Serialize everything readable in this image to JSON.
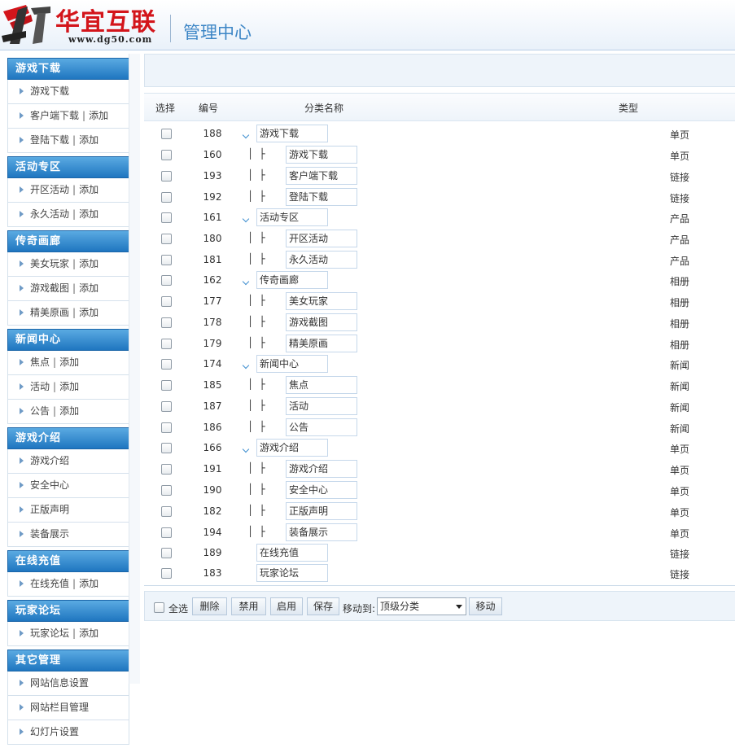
{
  "header": {
    "logo_text": "华宜互联",
    "logo_url": "www.dg50.com",
    "title": "管理中心"
  },
  "sidebar": {
    "add_label": "添加",
    "separator": "|",
    "groups": [
      {
        "title": "游戏下载",
        "items": [
          {
            "label": "游戏下载",
            "has_add": false
          },
          {
            "label": "客户端下载",
            "has_add": true
          },
          {
            "label": "登陆下载",
            "has_add": true
          }
        ]
      },
      {
        "title": "活动专区",
        "items": [
          {
            "label": "开区活动",
            "has_add": true
          },
          {
            "label": "永久活动",
            "has_add": true
          }
        ]
      },
      {
        "title": "传奇画廊",
        "items": [
          {
            "label": "美女玩家",
            "has_add": true
          },
          {
            "label": "游戏截图",
            "has_add": true
          },
          {
            "label": "精美原画",
            "has_add": true
          }
        ]
      },
      {
        "title": "新闻中心",
        "items": [
          {
            "label": "焦点",
            "has_add": true
          },
          {
            "label": "活动",
            "has_add": true
          },
          {
            "label": "公告",
            "has_add": true
          }
        ]
      },
      {
        "title": "游戏介绍",
        "items": [
          {
            "label": "游戏介绍",
            "has_add": false
          },
          {
            "label": "安全中心",
            "has_add": false
          },
          {
            "label": "正版声明",
            "has_add": false
          },
          {
            "label": "装备展示",
            "has_add": false
          }
        ]
      },
      {
        "title": "在线充值",
        "items": [
          {
            "label": "在线充值",
            "has_add": true
          }
        ]
      },
      {
        "title": "玩家论坛",
        "items": [
          {
            "label": "玩家论坛",
            "has_add": true
          }
        ]
      },
      {
        "title": "其它管理",
        "items": [
          {
            "label": "网站信息设置",
            "has_add": false
          },
          {
            "label": "网站栏目管理",
            "has_add": false
          },
          {
            "label": "幻灯片设置",
            "has_add": false
          }
        ]
      }
    ]
  },
  "table": {
    "headers": {
      "select": "选择",
      "id": "编号",
      "name": "分类名称",
      "type": "类型"
    },
    "tree_branch": "│ ├",
    "rows": [
      {
        "id": "188",
        "name": "游戏下载",
        "type": "单页",
        "level": 0,
        "arrow": true
      },
      {
        "id": "160",
        "name": "游戏下载",
        "type": "单页",
        "level": 1,
        "arrow": false
      },
      {
        "id": "193",
        "name": "客户端下载",
        "type": "链接",
        "level": 1,
        "arrow": false
      },
      {
        "id": "192",
        "name": "登陆下载",
        "type": "链接",
        "level": 1,
        "arrow": false
      },
      {
        "id": "161",
        "name": "活动专区",
        "type": "产品",
        "level": 0,
        "arrow": true
      },
      {
        "id": "180",
        "name": "开区活动",
        "type": "产品",
        "level": 1,
        "arrow": false
      },
      {
        "id": "181",
        "name": "永久活动",
        "type": "产品",
        "level": 1,
        "arrow": false
      },
      {
        "id": "162",
        "name": "传奇画廊",
        "type": "相册",
        "level": 0,
        "arrow": true
      },
      {
        "id": "177",
        "name": "美女玩家",
        "type": "相册",
        "level": 1,
        "arrow": false
      },
      {
        "id": "178",
        "name": "游戏截图",
        "type": "相册",
        "level": 1,
        "arrow": false
      },
      {
        "id": "179",
        "name": "精美原画",
        "type": "相册",
        "level": 1,
        "arrow": false
      },
      {
        "id": "174",
        "name": "新闻中心",
        "type": "新闻",
        "level": 0,
        "arrow": true
      },
      {
        "id": "185",
        "name": "焦点",
        "type": "新闻",
        "level": 1,
        "arrow": false
      },
      {
        "id": "187",
        "name": "活动",
        "type": "新闻",
        "level": 1,
        "arrow": false
      },
      {
        "id": "186",
        "name": "公告",
        "type": "新闻",
        "level": 1,
        "arrow": false
      },
      {
        "id": "166",
        "name": "游戏介绍",
        "type": "单页",
        "level": 0,
        "arrow": true
      },
      {
        "id": "191",
        "name": "游戏介绍",
        "type": "单页",
        "level": 1,
        "arrow": false
      },
      {
        "id": "190",
        "name": "安全中心",
        "type": "单页",
        "level": 1,
        "arrow": false
      },
      {
        "id": "182",
        "name": "正版声明",
        "type": "单页",
        "level": 1,
        "arrow": false
      },
      {
        "id": "194",
        "name": "装备展示",
        "type": "单页",
        "level": 1,
        "arrow": false
      },
      {
        "id": "189",
        "name": "在线充值",
        "type": "链接",
        "level": 0,
        "arrow": false
      },
      {
        "id": "183",
        "name": "玩家论坛",
        "type": "链接",
        "level": 0,
        "arrow": false
      }
    ]
  },
  "bottombar": {
    "select_all": "全选",
    "buttons": {
      "delete": "删除",
      "disable": "禁用",
      "enable": "启用",
      "save": "保存",
      "move": "移动"
    },
    "move_to_label": "移动到:",
    "move_target": "顶级分类"
  },
  "colors": {
    "brand_red": "#d3151b",
    "accent_blue": "#3d86c6",
    "sidebar_header": "#1f76c0"
  }
}
